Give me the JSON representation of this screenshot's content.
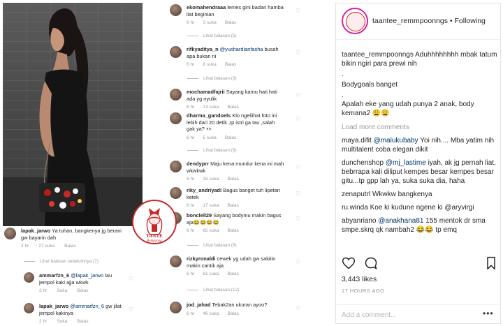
{
  "watermark": {
    "line1": "TANTE",
    "line2": "Rempoong"
  },
  "photo_comment": {
    "user": "lapak_jarwo",
    "text": "Ya tuhan, bangkenya jg berani gw bayarin dah",
    "time": "2 hr",
    "likes": "27 suka",
    "reply": "Balas",
    "thread": "Lihat balasan sebelumnya (7)"
  },
  "photo_replies": [
    {
      "user": "ammarfzn_6",
      "mention": "@lapak_jarwo",
      "text": "lau jempol kaki ajja wkwk",
      "time": "2 hr",
      "likes": "Suka",
      "reply": "Balas"
    },
    {
      "user": "lapak_jarwo",
      "mention": "@ammarfzn_6",
      "text": "gw jilat jempol kakinya",
      "time": "2 hr",
      "likes": "Suka",
      "reply": "Balas"
    }
  ],
  "comments": [
    {
      "user": "ekomahendraaa",
      "text": "lemes gini badan hamba liat beginian",
      "time": "6 hr",
      "likes": "3 suka",
      "reply": "Balas",
      "thread": "Lihat balasan (5)"
    },
    {
      "user": "rifkyaditya_n",
      "mention": "@yushardianfasha",
      "text": "busah apa bukan ni",
      "time": "6 hr",
      "likes": "8 suka",
      "reply": "Balas",
      "thread": "Lihat balasan (3)"
    },
    {
      "user": "mochamadfajrii",
      "text": "Sayang kamu hati hati ada yg nyulik",
      "time": "6 hr",
      "likes": "13 suka",
      "reply": "Balas"
    },
    {
      "user": "dharma_gandoels",
      "text": "Klo ngeliihat foto ini lebih dari 20 detik ,tp istri ga tau ,salah gak ya? 👀",
      "time": "6 hr",
      "likes": "5 suka",
      "reply": "Balas",
      "thread": "Lihat balasan (9)"
    },
    {
      "user": "dendyprr",
      "text": "Maju kena mundur kena ini mah wkwkwk",
      "time": "6 hr",
      "likes": "15 suka",
      "reply": "Balas"
    },
    {
      "user": "riky_andriyadi",
      "text": "Bagus banget tuh lipetan ketek",
      "time": "6 hr",
      "likes": "17 suka",
      "reply": "Balas"
    },
    {
      "user": "bonclell29",
      "text": "Sayang bodymu makin bagus aja😂😂😂😂",
      "time": "6 hr",
      "likes": "65 suka",
      "reply": "Balas",
      "thread": "Lihat balasan (9)"
    },
    {
      "user": "rizkyronaldi",
      "text": "cewek yg udah gw sakitin makin cantik aja",
      "time": "6 hr",
      "likes": "61 suka",
      "reply": "Balas",
      "thread": "Lihat balasan (12)"
    },
    {
      "user": "jod_jahad",
      "text": "Tebak2an ukuran ayoo?",
      "time": "6 hr",
      "likes": "46 suka",
      "reply": "Balas"
    }
  ],
  "post": {
    "username": "taantee_remmpoonngs",
    "follow": "• Following",
    "caption_user": "taantee_remmpoonngs",
    "caption": "Aduhhhhhhhh mbak tatum bikin ngiri para prewi nih",
    "caption_dot": ".",
    "caption2": "Bodygoals banget",
    "caption_dot2": ".",
    "caption3": "Apalah eke yang udah punya 2 anak, body kemana2 😩😩",
    "load_more": "Load more comments",
    "comments": [
      {
        "user": "maya.difit",
        "mention": "@malukubaby",
        "text": "Yoi nih.... Mba yatim nih multitalent coba elegan dikit"
      },
      {
        "user": "dunchenshop",
        "mention": "@mj_lastime",
        "text": "iyah, ak jg pernah liat, bebrrapa kali diliput kempes besar kempes besar gitu...tp gpp lah ya, suka suka dia, haha"
      },
      {
        "user": "zenaputrl",
        "mention": "",
        "text": "Wkwkw bangkenya"
      },
      {
        "user": "ru.winda",
        "mention": "",
        "text": "Koe ki kudune ngene ki @aryvirgi"
      },
      {
        "user": "abyanriano",
        "mention": "@anakhana81",
        "text": "155 mentok dr sma smpe.skrq qk nambah2 😂😂 tp emq"
      }
    ],
    "likes": "3,443 likes",
    "ago": "17 HOURS AGO",
    "add_comment": "Add a comment...",
    "more": "•••"
  },
  "colors": {
    "accent": "#c62828",
    "mention": "#003569",
    "muted": "#999999"
  },
  "icons": [
    "heart-icon",
    "comment-icon",
    "bookmark-icon",
    "more-icon"
  ]
}
